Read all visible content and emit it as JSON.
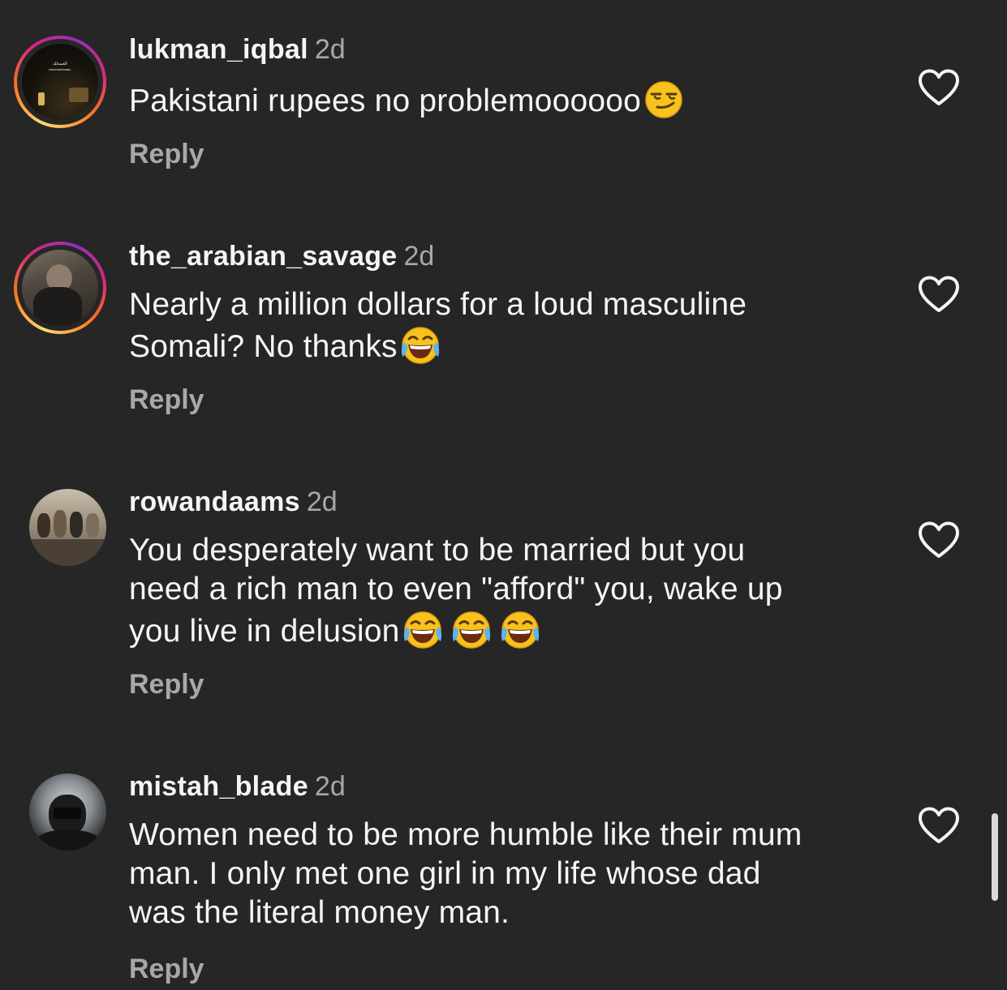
{
  "comments": [
    {
      "username": "lukman_iqbal",
      "time": "2d",
      "text": "Pakistani rupees no problemoooooo",
      "emoji": "smirking-face",
      "reply": "Reply",
      "avatar_text_1": "الحمدلله",
      "avatar_text_2": "FOR EVERYTHING."
    },
    {
      "username": "the_arabian_savage",
      "time": "2d",
      "text_line1": "Nearly a million dollars for a loud masculine",
      "text_line2": "Somali? No thanks",
      "emoji": "face-with-tears-of-joy",
      "reply": "Reply"
    },
    {
      "username": "rowandaams",
      "time": "2d",
      "text_line1": "You desperately want to be married but you",
      "text_line2": "need a rich man to even \"afford\" you, wake up",
      "text_line3": "you live in delusion",
      "emoji": "face-with-tears-of-joy",
      "emoji_count": 3,
      "reply": "Reply"
    },
    {
      "username": "mistah_blade",
      "time": "2d",
      "text_line1": "Women need to be more humble like their mum",
      "text_line2": "man. I only met one girl in my life whose dad",
      "text_line3": "was the literal money man.",
      "reply": "Reply"
    }
  ],
  "colors": {
    "background": "#262626",
    "primary_text": "#f5f5f5",
    "secondary_text": "#a8a8a8",
    "story_ring": [
      "#feda75",
      "#fa7e1e",
      "#d62976",
      "#962fbf"
    ]
  },
  "icons": {
    "like": "heart-outline-icon"
  }
}
